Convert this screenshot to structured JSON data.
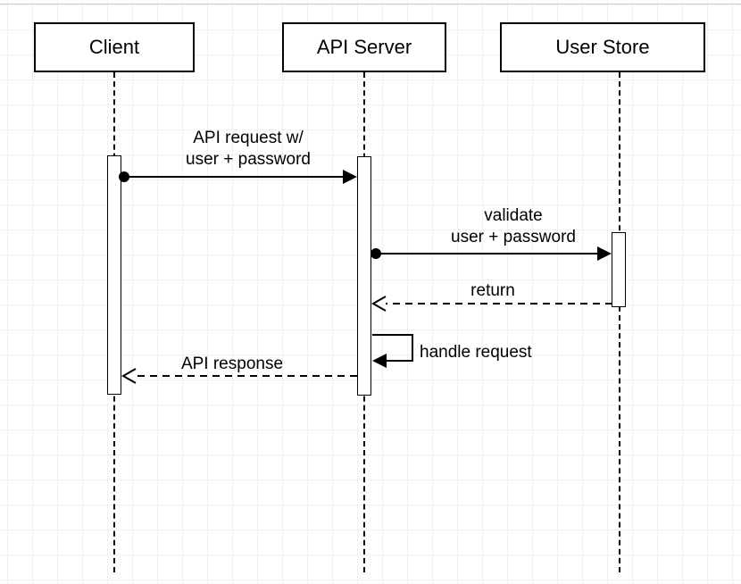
{
  "participants": {
    "client": "Client",
    "api_server": "API Server",
    "user_store": "User Store"
  },
  "messages": {
    "m1_line1": "API request w/",
    "m1_line2": "user + password",
    "m2_line1": "validate",
    "m2_line2": "user + password",
    "m3": "return",
    "m4": "handle request",
    "m5": "API response"
  }
}
